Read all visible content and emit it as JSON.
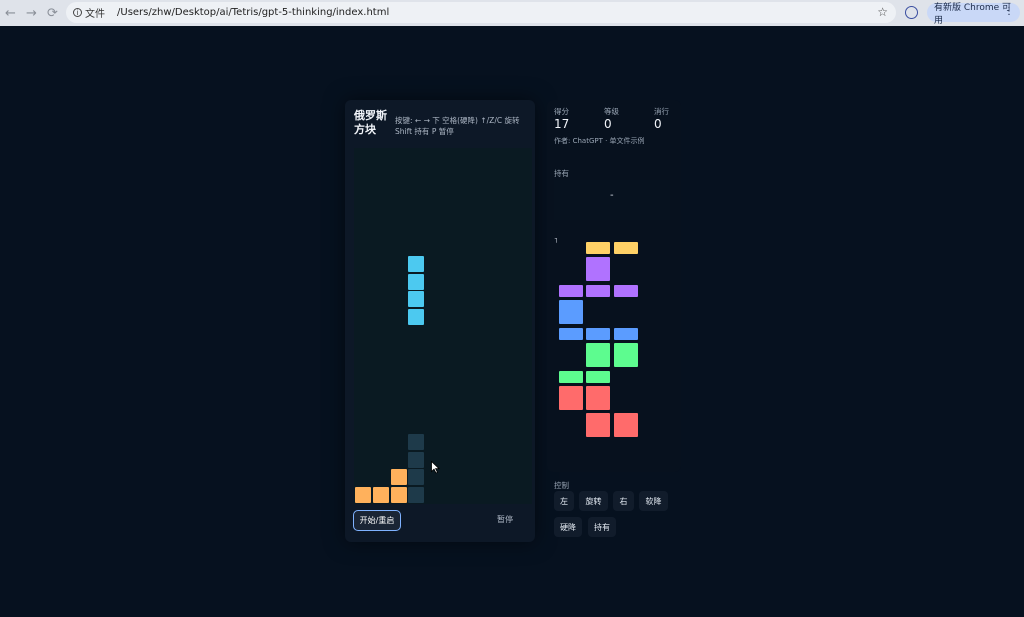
{
  "browser": {
    "back_icon": "←",
    "forward_icon": "→",
    "reload_icon": "⟳",
    "site_info": "文件",
    "url": "/Users/zhw/Desktop/ai/Tetris/gpt-5-thinking/index.html",
    "star_icon": "☆",
    "update_label": "有新版 Chrome 可用",
    "menu_icon": "⋮"
  },
  "game": {
    "title": "俄罗斯方块",
    "keys_line1": "按键: ← → 下 空格(硬降) ↑/Z/C 旋转",
    "keys_line2": "Shift 持有 P 暂停",
    "restart_label": "开始/重启",
    "pause_label": "暂停",
    "colors": {
      "I": "#4cc9f0",
      "L": "#ffb15c",
      "ghost": "#1e3a4a",
      "T": "#b072ff",
      "J": "#5b9cff",
      "S": "#5dfc8f",
      "Z": "#ff6b6b",
      "O": "#ffd166"
    }
  },
  "stats": {
    "score_label": "得分",
    "score": "17",
    "level_label": "等级",
    "level": "0",
    "lines_label": "消行",
    "lines": "0",
    "author": "作者: ChatGPT · 单文件示例"
  },
  "hold": {
    "label": "持有",
    "value": "-"
  },
  "next": {
    "tick": "˥"
  },
  "controls": {
    "label": "控制",
    "left": "左",
    "rotate": "旋转",
    "right": "右",
    "soft_drop": "软降",
    "hard_drop": "硬降",
    "hold": "持有"
  }
}
